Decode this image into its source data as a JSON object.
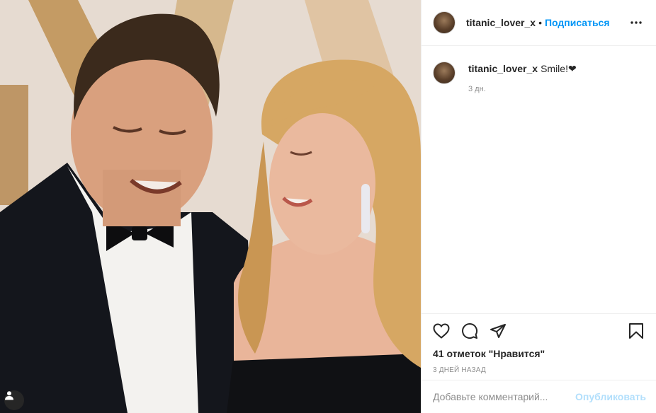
{
  "photo": {
    "alt": "",
    "user_tag_icon": "user-tag-icon"
  },
  "header": {
    "username": "titanic_lover_x",
    "separator": "•",
    "follow_label": "Подписаться",
    "more_icon": "more-options-icon"
  },
  "caption": {
    "username": "titanic_lover_x",
    "text": "Smile!❤︎",
    "time": "3 дн."
  },
  "actions": {
    "like_icon": "heart-icon",
    "comment_icon": "comment-icon",
    "share_icon": "share-icon",
    "save_icon": "bookmark-icon",
    "likes_text": "41 отметок \"Нравится\"",
    "date_text": "3 дней назад"
  },
  "comment_form": {
    "placeholder": "Добавьте комментарий...",
    "publish_label": "Опубликовать"
  },
  "colors": {
    "link_blue": "#0095f6",
    "publish_disabled": "#b2dffc",
    "muted_text": "#8e8e8e",
    "border": "#efefef"
  }
}
